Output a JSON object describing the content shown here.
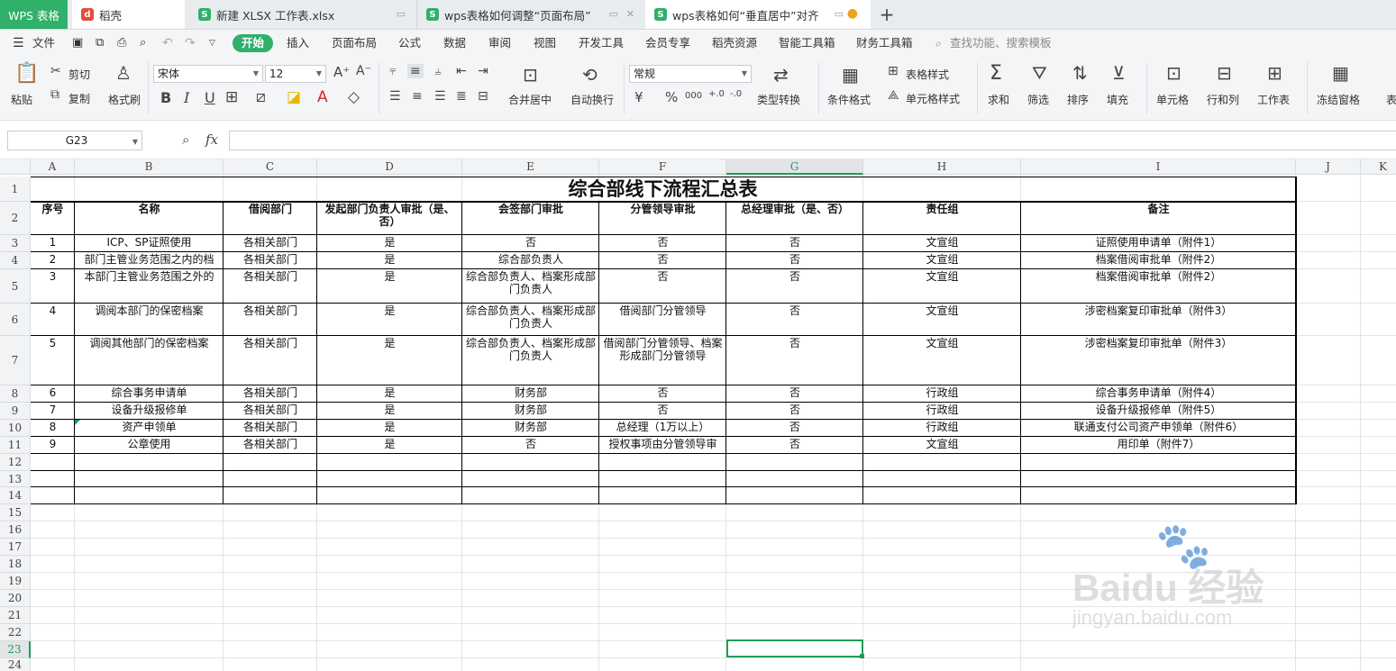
{
  "tabs": {
    "app": "WPS 表格",
    "t1": "稻壳",
    "t2": "新建 XLSX 工作表.xlsx",
    "t3": "wps表格如何调整“页面布局”",
    "t4": "wps表格如何“垂直居中”对齐",
    "new_tab": "+"
  },
  "menu": {
    "file": "文件",
    "start": "开始",
    "insert": "插入",
    "layout": "页面布局",
    "formula": "公式",
    "data": "数据",
    "review": "审阅",
    "view": "视图",
    "dev": "开发工具",
    "member": "会员专享",
    "docer": "稻壳资源",
    "smart": "智能工具箱",
    "finance": "财务工具箱",
    "search": "查找功能、搜索模板"
  },
  "ribbon": {
    "paste": "粘贴",
    "cut": "剪切",
    "copy": "复制",
    "format_painter": "格式刷",
    "font_name": "宋体",
    "font_size": "12",
    "merge_center": "合并居中",
    "auto_wrap": "自动换行",
    "number_format": "常规",
    "type_convert": "类型转换",
    "cond_format": "条件格式",
    "table_style": "表格样式",
    "cell_style": "单元格样式",
    "sum": "求和",
    "filter": "筛选",
    "sort": "排序",
    "fill": "填充",
    "cell": "单元格",
    "rowcol": "行和列",
    "sheet": "工作表",
    "freeze": "冻结窗格",
    "more": "表",
    "bold": "B",
    "italic": "I",
    "underline": "U",
    "currency": "¥",
    "percent": "%"
  },
  "formula_bar": {
    "name_box": "G23",
    "fx": "fx",
    "content": ""
  },
  "columns": [
    "A",
    "B",
    "C",
    "D",
    "E",
    "F",
    "G",
    "H",
    "I",
    "J",
    "K"
  ],
  "rows": [
    "1",
    "2",
    "3",
    "4",
    "5",
    "6",
    "7",
    "8",
    "9",
    "10",
    "11",
    "12",
    "13",
    "14",
    "15",
    "16",
    "17",
    "18",
    "19",
    "20",
    "21",
    "22",
    "23",
    "24"
  ],
  "sheet": {
    "title": "综合部线下流程汇总表",
    "headers": [
      "序号",
      "名称",
      "借阅部门",
      "发起部门负责人审批（是、否）",
      "会签部门审批",
      "分管领导审批",
      "总经理审批（是、否）",
      "责任组",
      "备注"
    ],
    "rows": [
      [
        "1",
        "ICP、SP证照使用",
        "各相关部门",
        "是",
        "否",
        "否",
        "否",
        "文宣组",
        "证照使用申请单（附件1）"
      ],
      [
        "2",
        "部门主管业务范围之内的档",
        "各相关部门",
        "是",
        "综合部负责人",
        "否",
        "否",
        "文宣组",
        "档案借阅审批单（附件2）"
      ],
      [
        "3",
        "本部门主管业务范围之外的",
        "各相关部门",
        "是",
        "综合部负责人、档案形成部门负责人",
        "否",
        "否",
        "文宣组",
        "档案借阅审批单（附件2）"
      ],
      [
        "4",
        "调阅本部门的保密档案",
        "各相关部门",
        "是",
        "综合部负责人、档案形成部门负责人",
        "借阅部门分管领导",
        "否",
        "文宣组",
        "涉密档案复印审批单（附件3）"
      ],
      [
        "5",
        "调阅其他部门的保密档案",
        "各相关部门",
        "是",
        "综合部负责人、档案形成部门负责人",
        "借阅部门分管领导、档案形成部门分管领导",
        "否",
        "文宣组",
        "涉密档案复印审批单（附件3）"
      ],
      [
        "6",
        "综合事务申请单",
        "各相关部门",
        "是",
        "财务部",
        "否",
        "否",
        "行政组",
        "综合事务申请单（附件4）"
      ],
      [
        "7",
        "设备升级报修单",
        "各相关部门",
        "是",
        "财务部",
        "否",
        "否",
        "行政组",
        "设备升级报修单（附件5）"
      ],
      [
        "8",
        "资产申领单",
        "各相关部门",
        "是",
        "财务部",
        "总经理（1万以上）",
        "否",
        "行政组",
        "联通支付公司资产申领单（附件6）"
      ],
      [
        "9",
        "公章使用",
        "各相关部门",
        "是",
        "否",
        "授权事项由分管领导审",
        "否",
        "文宣组",
        "用印单（附件7）"
      ]
    ]
  },
  "watermark": {
    "brand": "Baidu 经验",
    "url": "jingyan.baidu.com"
  },
  "colors": {
    "accent_green": "#2fb06b",
    "wps_red": "#e64b3c",
    "selected_border": "#1f9d55"
  }
}
